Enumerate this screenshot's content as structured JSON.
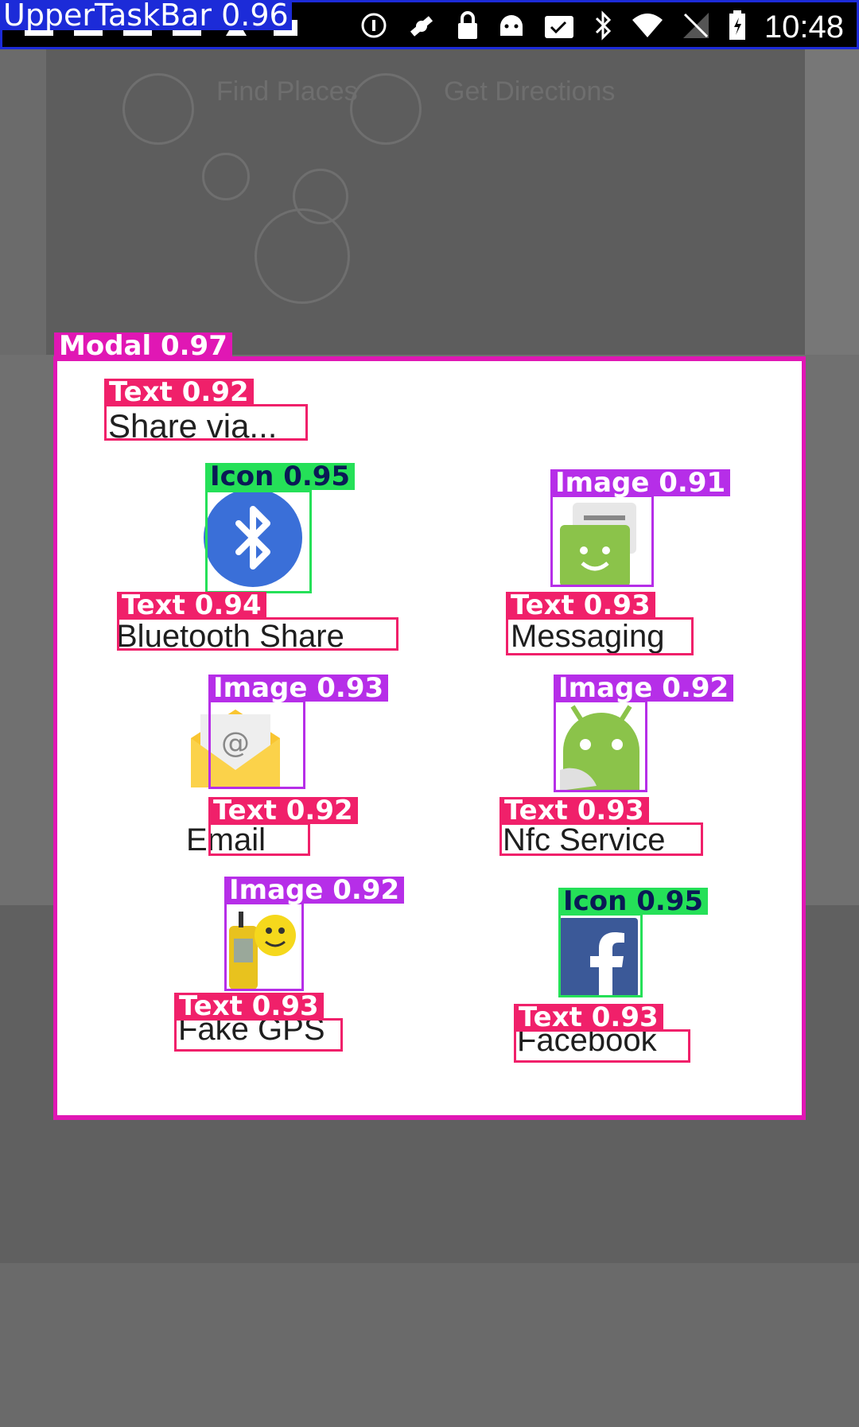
{
  "status_bar": {
    "time": "10:48",
    "left_icons": [
      "notification-icon",
      "notification-icon",
      "notification-icon",
      "notification-icon",
      "alert-icon",
      "mail-icon"
    ],
    "right_icons": [
      "info-icon",
      "fake-location-icon",
      "lock-icon",
      "android-icon",
      "clipboard-icon",
      "bluetooth-icon",
      "wifi-icon",
      "no-signal-icon",
      "battery-icon"
    ]
  },
  "background": {
    "tab_find_places": "Find Places",
    "tab_get_directions": "Get Directions"
  },
  "share_dialog": {
    "title": "Share via...",
    "items": [
      {
        "label": "Bluetooth Share",
        "icon": "bluetooth-icon"
      },
      {
        "label": "Messaging",
        "icon": "messaging-app-icon"
      },
      {
        "label": "Email",
        "icon": "email-app-icon"
      },
      {
        "label": "Nfc Service",
        "icon": "nfc-service-icon"
      },
      {
        "label": "Fake GPS",
        "icon": "fake-gps-icon"
      },
      {
        "label": "Facebook",
        "icon": "facebook-icon"
      }
    ]
  },
  "detections": {
    "taskbar": "UpperTaskBar  0.96",
    "modal": "Modal  0.97",
    "title_text": "Text  0.92",
    "bluetooth_icon": "Icon  0.95",
    "bluetooth_text": "Text  0.94",
    "messaging_image": "Image  0.91",
    "messaging_text": "Text  0.93",
    "email_image": "Image  0.93",
    "email_text": "Text  0.92",
    "nfc_image": "Image  0.92",
    "nfc_text": "Text  0.93",
    "fakegps_image": "Image  0.92",
    "fakegps_text": "Text  0.93",
    "facebook_icon": "Icon  0.95",
    "facebook_text": "Text  0.93"
  },
  "colors": {
    "modal_box": "#e017b4",
    "text_box": "#f0206a",
    "icon_box": "#25e058",
    "image_box": "#b62ee8",
    "taskbar_box": "#1c2bd8",
    "scrim": "#6b6b6b"
  }
}
